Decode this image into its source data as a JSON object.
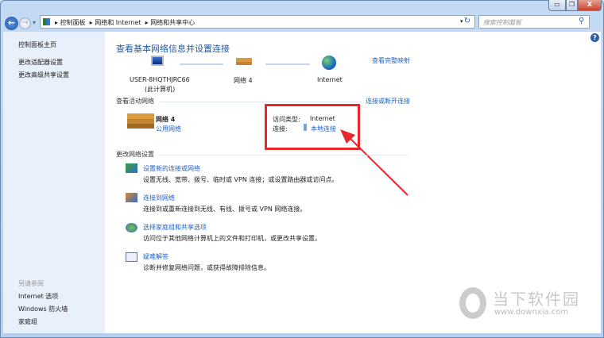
{
  "window": {
    "minimize": "▭",
    "restore": "❐",
    "close": "X"
  },
  "nav": {
    "back": "←",
    "forward": "→",
    "dropdown": "▾",
    "refresh": "↻"
  },
  "breadcrumb": [
    "控制面板",
    "网络和 Internet",
    "网络和共享中心"
  ],
  "search": {
    "placeholder": "搜索控制面板",
    "icon": "search-icon"
  },
  "help": "?",
  "sidebar": {
    "home": "控制面板主页",
    "items": [
      "更改适配器设置",
      "更改高级共享设置"
    ],
    "see_also_title": "另请参阅",
    "see_also": [
      "Internet 选项",
      "Windows 防火墙",
      "家庭组"
    ]
  },
  "main": {
    "title": "查看基本网络信息并设置连接",
    "map": {
      "computer": "USER-8HQTHJRC66",
      "computer_sub": "(此计算机)",
      "network": "网络  4",
      "internet": "Internet",
      "full_map": "查看完整映射"
    },
    "active_title": "查看活动网络",
    "connect_link": "连接或断开连接",
    "active": {
      "name": "网络  4",
      "type": "公用网络",
      "access_label": "访问类型:",
      "access_value": "Internet",
      "conn_label": "连接:",
      "conn_value": "本地连接"
    },
    "change_title": "更改网络设置",
    "tasks": [
      {
        "link": "设置新的连接或网络",
        "desc": "设置无线、宽带、拨号、临时或 VPN 连接；或设置路由器或访问点。"
      },
      {
        "link": "连接到网络",
        "desc": "连接到或重新连接到无线、有线、拨号或 VPN 网络连接。"
      },
      {
        "link": "选择家庭组和共享选项",
        "desc": "访问位于其他网络计算机上的文件和打印机，或更改共享设置。"
      },
      {
        "link": "疑难解答",
        "desc": "诊断并修复网络问题，或获得故障排除信息。"
      }
    ]
  },
  "watermark": {
    "cn": "当下软件园",
    "url": "www.downxia.com"
  },
  "colors": {
    "annotation": "#e8262b",
    "link": "#1f62c4"
  }
}
